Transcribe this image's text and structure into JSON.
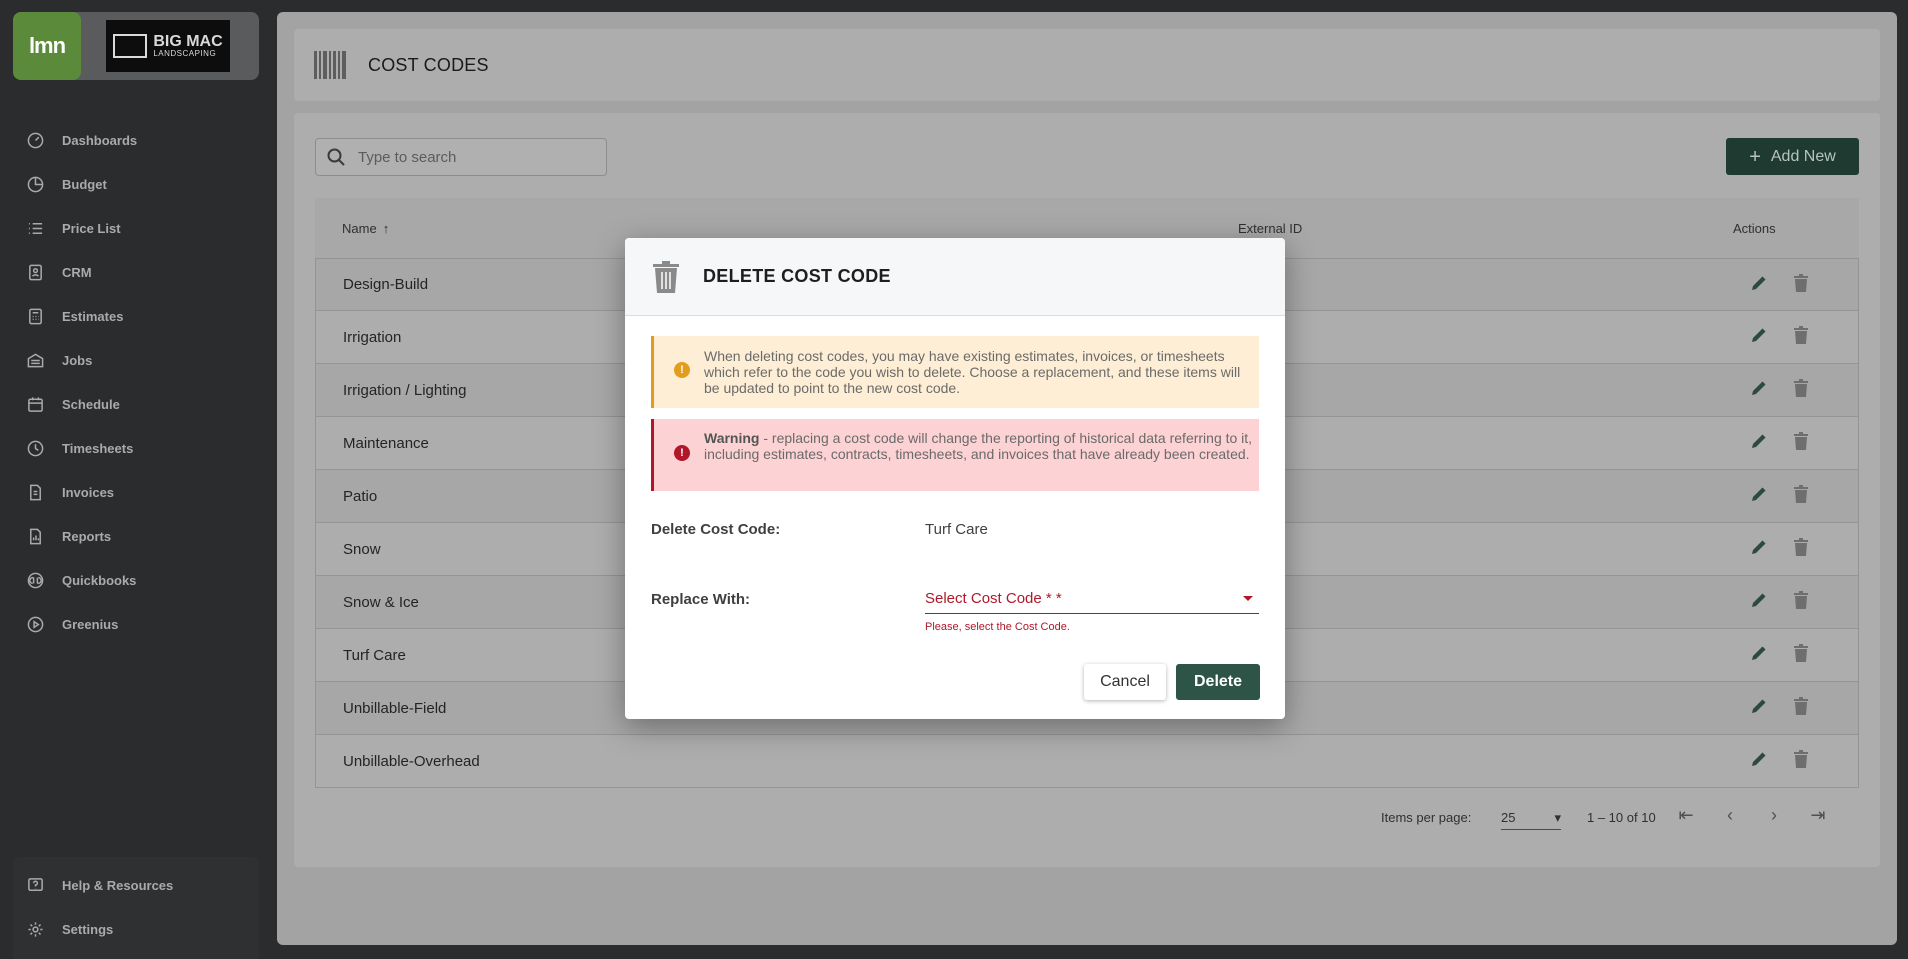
{
  "brand": {
    "lmn_logo": "lmn",
    "company_logo_big": "BIG MAC",
    "company_logo_small": "LANDSCAPING"
  },
  "sidebar": {
    "items": [
      {
        "label": "Dashboards",
        "icon": "dashboard-icon"
      },
      {
        "label": "Budget",
        "icon": "pie-chart-icon"
      },
      {
        "label": "Price List",
        "icon": "list-icon"
      },
      {
        "label": "CRM",
        "icon": "contact-card-icon"
      },
      {
        "label": "Estimates",
        "icon": "calculator-icon"
      },
      {
        "label": "Jobs",
        "icon": "building-icon"
      },
      {
        "label": "Schedule",
        "icon": "calendar-icon"
      },
      {
        "label": "Timesheets",
        "icon": "clock-icon"
      },
      {
        "label": "Invoices",
        "icon": "invoice-icon"
      },
      {
        "label": "Reports",
        "icon": "report-icon"
      },
      {
        "label": "Quickbooks",
        "icon": "quickbooks-icon"
      },
      {
        "label": "Greenius",
        "icon": "play-circle-icon"
      }
    ],
    "bottom": [
      {
        "label": "Help & Resources",
        "icon": "help-icon"
      },
      {
        "label": "Settings",
        "icon": "gear-icon"
      }
    ]
  },
  "page": {
    "title": "COST CODES"
  },
  "search": {
    "placeholder": "Type to search"
  },
  "toolbar": {
    "add_label": "Add New"
  },
  "table": {
    "columns": {
      "name": "Name",
      "external_id": "External ID",
      "actions": "Actions"
    },
    "rows": [
      "Design-Build",
      "Irrigation",
      "Irrigation / Lighting",
      "Maintenance",
      "Patio",
      "Snow",
      "Snow & Ice",
      "Turf Care",
      "Unbillable-Field",
      "Unbillable-Overhead"
    ]
  },
  "pager": {
    "items_per_page_label": "Items per page:",
    "items_per_page": "25",
    "range": "1 – 10 of 10"
  },
  "dialog": {
    "title": "DELETE COST CODE",
    "info_text": "When deleting cost codes, you may have existing estimates, invoices, or timesheets which refer to the code you wish to delete. Choose a replacement, and these items will be updated to point to the new cost code.",
    "warning_bold": "Warning",
    "warning_text": " - replacing a cost code will change the reporting of historical data referring to it, including estimates, contracts, timesheets, and invoices that have already been created.",
    "delete_label": "Delete Cost Code:",
    "delete_value": "Turf Care",
    "replace_label": "Replace With:",
    "select_placeholder": "Select Cost Code * *",
    "error": "Please, select the Cost Code.",
    "cancel": "Cancel",
    "confirm": "Delete"
  },
  "colors": {
    "accent": "#2d5446",
    "error": "#b0182a",
    "info": "#e39d1c",
    "lmn_green": "#5b8a3a"
  }
}
